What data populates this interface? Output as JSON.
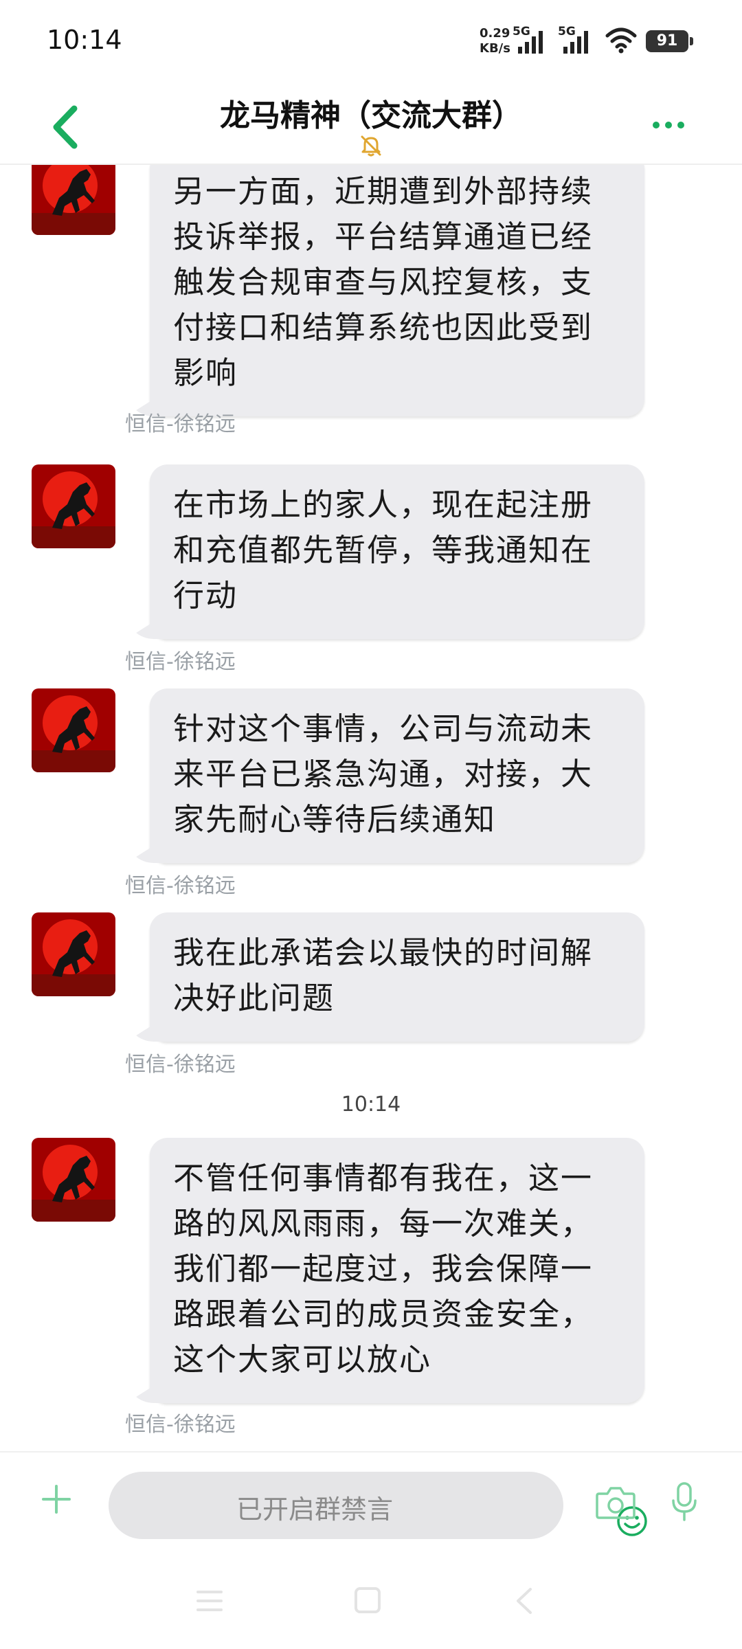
{
  "status_bar": {
    "time": "10:14",
    "net_speed_value": "0.29",
    "net_speed_unit": "KB/s",
    "signal1_label": "5G",
    "signal2_label": "5G",
    "battery": "91"
  },
  "header": {
    "title": "龙马精神（交流大群）",
    "back_icon": "chevron-left-icon",
    "mute_icon": "bell-off-icon",
    "more_icon": "more-dots-icon"
  },
  "messages": [
    {
      "sender": "恒信-徐铭远",
      "text": "另一方面，近期遭到外部持续投诉举报，平台结算通道已经触发合规审查与风控复核，支付接口和结算系统也因此受到影响"
    },
    {
      "sender": "恒信-徐铭远",
      "text": "在市场上的家人，现在起注册和充值都先暂停，等我通知在行动"
    },
    {
      "sender": "恒信-徐铭远",
      "text": "针对这个事情，公司与流动未来平台已紧急沟通，对接，大家先耐心等待后续通知"
    },
    {
      "sender": "恒信-徐铭远",
      "text": "我在此承诺会以最快的时间解决好此问题"
    },
    {
      "sender": "恒信-徐铭远",
      "text": "不管任何事情都有我在，这一路的风风雨雨，每一次难关，我们都一起度过，我会保障一路跟着公司的成员资金安全，这个大家可以放心"
    }
  ],
  "time_separator": "10:14",
  "input_bar": {
    "muted_placeholder": "已开启群禁言",
    "plus_icon": "plus-icon",
    "emoji_icon": "smile-icon",
    "camera_icon": "camera-icon",
    "mic_icon": "mic-icon"
  },
  "colors": {
    "accent": "#1aad5f",
    "bubble": "#ececef",
    "sender": "#9aa0a6"
  }
}
